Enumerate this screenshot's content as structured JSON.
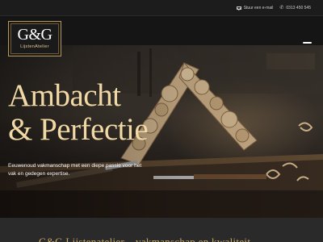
{
  "topbar": {
    "email_label": "Stuur een e-mail",
    "phone": "0313 450 545",
    "email_icon": "envelope-icon",
    "phone_icon": "phone-icon"
  },
  "logo": {
    "mark": "G&G",
    "subtitle": "LijstenAtelier"
  },
  "menu": {
    "icon": "hamburger-menu-icon"
  },
  "hero": {
    "title_line1": "Ambacht",
    "title_line2": "& Perfectie",
    "text": "Eeuwenoud vakmanschap met een diepe passie voor het vak en gedegen expertise."
  },
  "band": {
    "text": "G&G Lijstenatelier – vakmanschap en kwaliteit"
  },
  "colors": {
    "accent_gold": "#f1d9a6",
    "logo_gold": "#b8975a",
    "dark_bg": "#1b1b1b"
  }
}
